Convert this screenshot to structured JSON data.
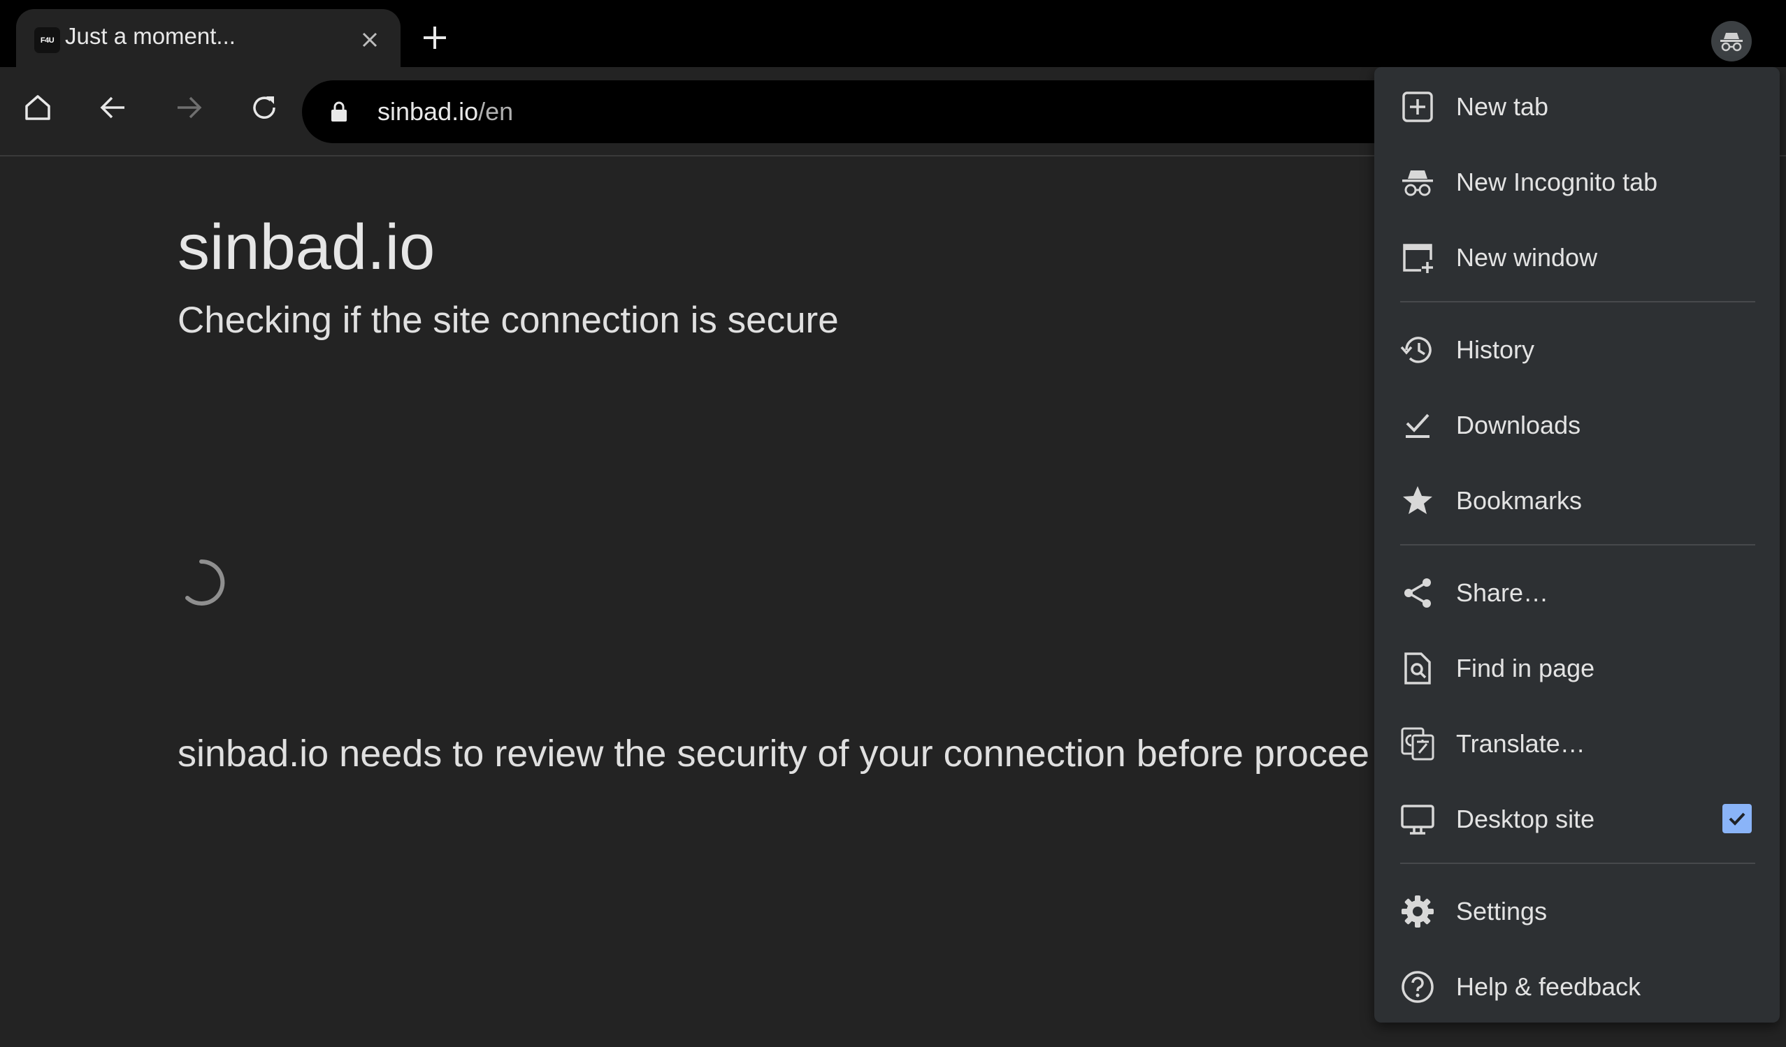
{
  "tab": {
    "favicon_text": "F4U",
    "title": "Just a moment..."
  },
  "omnibox": {
    "host": "sinbad.io",
    "path": "/en"
  },
  "page": {
    "site_name": "sinbad.io",
    "checking_text": "Checking if the site connection is secure",
    "review_text": "sinbad.io needs to review the security of your connection before procee"
  },
  "menu": {
    "items": [
      {
        "label": "New tab",
        "icon": "plus-box-icon"
      },
      {
        "label": "New Incognito tab",
        "icon": "incognito-icon"
      },
      {
        "label": "New window",
        "icon": "new-window-icon"
      },
      {
        "label": "History",
        "icon": "history-icon"
      },
      {
        "label": "Downloads",
        "icon": "download-check-icon"
      },
      {
        "label": "Bookmarks",
        "icon": "star-icon"
      },
      {
        "label": "Share…",
        "icon": "share-icon"
      },
      {
        "label": "Find in page",
        "icon": "find-in-page-icon"
      },
      {
        "label": "Translate…",
        "icon": "translate-icon"
      },
      {
        "label": "Desktop site",
        "icon": "monitor-icon",
        "checked": true
      },
      {
        "label": "Settings",
        "icon": "gear-icon"
      },
      {
        "label": "Help & feedback",
        "icon": "help-icon"
      }
    ]
  },
  "colors": {
    "background": "#232323",
    "tabstrip": "#000000",
    "menu_bg": "#2d3033",
    "accent": "#8ab4f8",
    "text": "#e3e3e3"
  }
}
